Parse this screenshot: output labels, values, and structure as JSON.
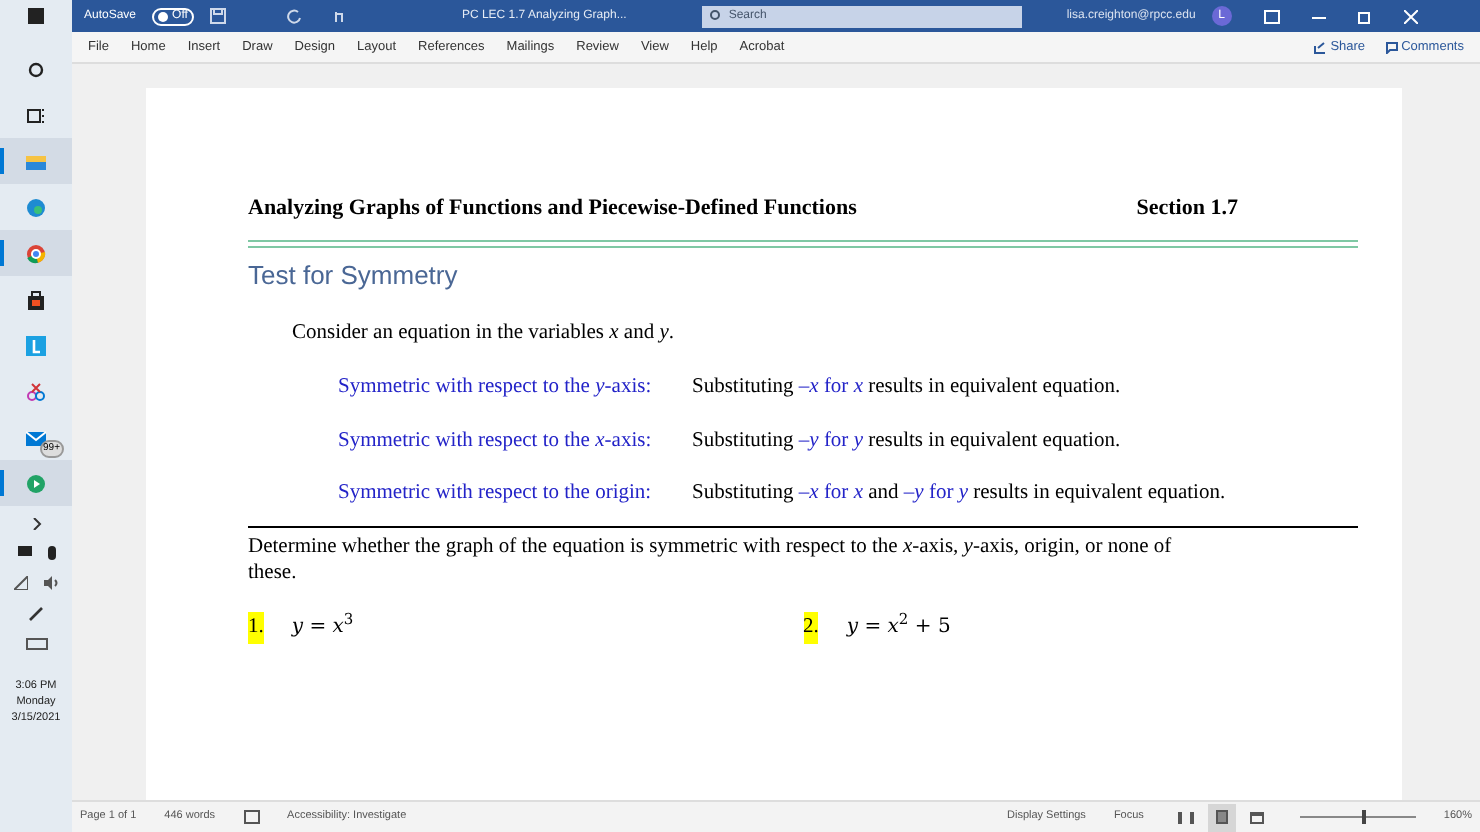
{
  "taskbar": {
    "apps": [
      {
        "kind": "search",
        "running": false
      },
      {
        "kind": "taskview",
        "running": false
      },
      {
        "kind": "explorer",
        "running": true
      },
      {
        "kind": "edge",
        "running": false
      },
      {
        "kind": "chrome",
        "running": true
      },
      {
        "kind": "store",
        "running": false
      },
      {
        "kind": "learn",
        "running": false
      },
      {
        "kind": "snip",
        "running": false
      },
      {
        "kind": "mail",
        "running": false,
        "badge": "99+"
      },
      {
        "kind": "app",
        "running": true
      }
    ],
    "time": "3:06 PM",
    "day": "Monday",
    "date": "3/15/2021"
  },
  "title_bar": {
    "autosave_label": "AutoSave",
    "autosave": {
      "on": false,
      "label": "Off"
    },
    "title": "PC LEC 1.7 Analyzing Graph...",
    "search": {
      "placeholder": "Search"
    },
    "account": "lisa.creighton@rpcc.edu",
    "avatar": "L"
  },
  "menu": {
    "items": [
      "File",
      "Home",
      "Insert",
      "Draw",
      "Design",
      "Layout",
      "References",
      "Mailings",
      "Review",
      "View",
      "Help",
      "Acrobat"
    ],
    "share": "Share",
    "comments": "Comments"
  },
  "document": {
    "header": "Analyzing Graphs of Functions and Piecewise-Defined Functions",
    "section": "Section 1.7",
    "heading": "Test for Symmetry",
    "intro": "Consider an equation in the variables *x* and *y*.",
    "rules": [
      {
        "label": "Symmetric with respect to the *y*-axis:",
        "segments": [
          {
            "kind": "plain",
            "text": "Substituting"
          },
          {
            "kind": "term",
            "text": "–*x* for *x*"
          },
          {
            "kind": "plain",
            "text": "results in equivalent equation."
          }
        ]
      },
      {
        "label": "Symmetric with respect to the *x*-axis:",
        "segments": [
          {
            "kind": "plain",
            "text": "Substituting"
          },
          {
            "kind": "term",
            "text": "–*y* for *y*"
          },
          {
            "kind": "plain",
            "text": "results in equivalent equation."
          }
        ]
      },
      {
        "label": "Symmetric with respect to the origin:",
        "segments": [
          {
            "kind": "plain",
            "text": "Substituting"
          },
          {
            "kind": "term",
            "text": "–*x* for *x*"
          },
          {
            "kind": "plain",
            "text": "and"
          },
          {
            "kind": "term",
            "text": "–*y* for *y*"
          },
          {
            "kind": "plain",
            "text": "results in equivalent equation."
          }
        ]
      }
    ],
    "instructions": "Determine whether the graph of the equation is symmetric with respect to the *x*-axis, *y*-axis, origin, or none of these.",
    "problems": [
      {
        "number": "1.",
        "equation": "*y* = *x*$^{3}$"
      },
      {
        "number": "2.",
        "equation": "*y* = *x*$^{2}$ + 5"
      }
    ]
  },
  "status_bar": {
    "page": "Page 1 of 1",
    "words": "446 words",
    "accessibility": "Accessibility: Investigate",
    "display_settings": "Display Settings",
    "focus": "Focus",
    "views": [
      {
        "kind": "read",
        "selected": false
      },
      {
        "kind": "print",
        "selected": true
      },
      {
        "kind": "web",
        "selected": false
      }
    ],
    "zoom": {
      "level": 0.55,
      "label": "160%"
    }
  }
}
